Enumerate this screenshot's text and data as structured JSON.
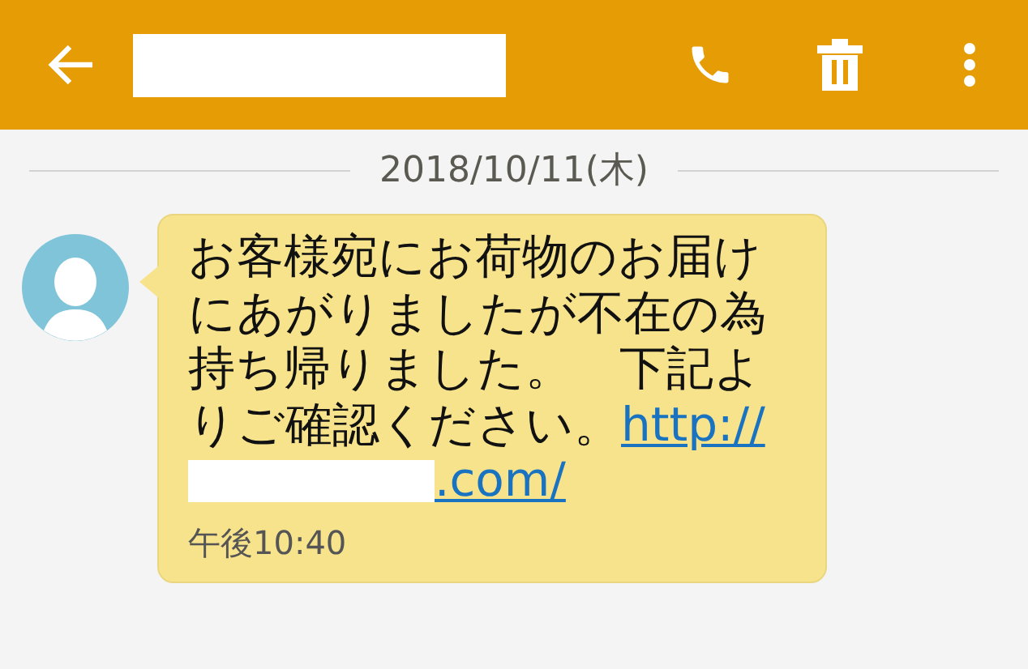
{
  "date_divider": "2018/10/11(木)",
  "messages": [
    {
      "text": "お客様宛にお荷物のお届けにあがりましたが不在の為持ち帰りました。　下記よりご確認ください。",
      "link_start": "http://",
      "link_end": ".com/",
      "time": "午後10:40"
    }
  ]
}
